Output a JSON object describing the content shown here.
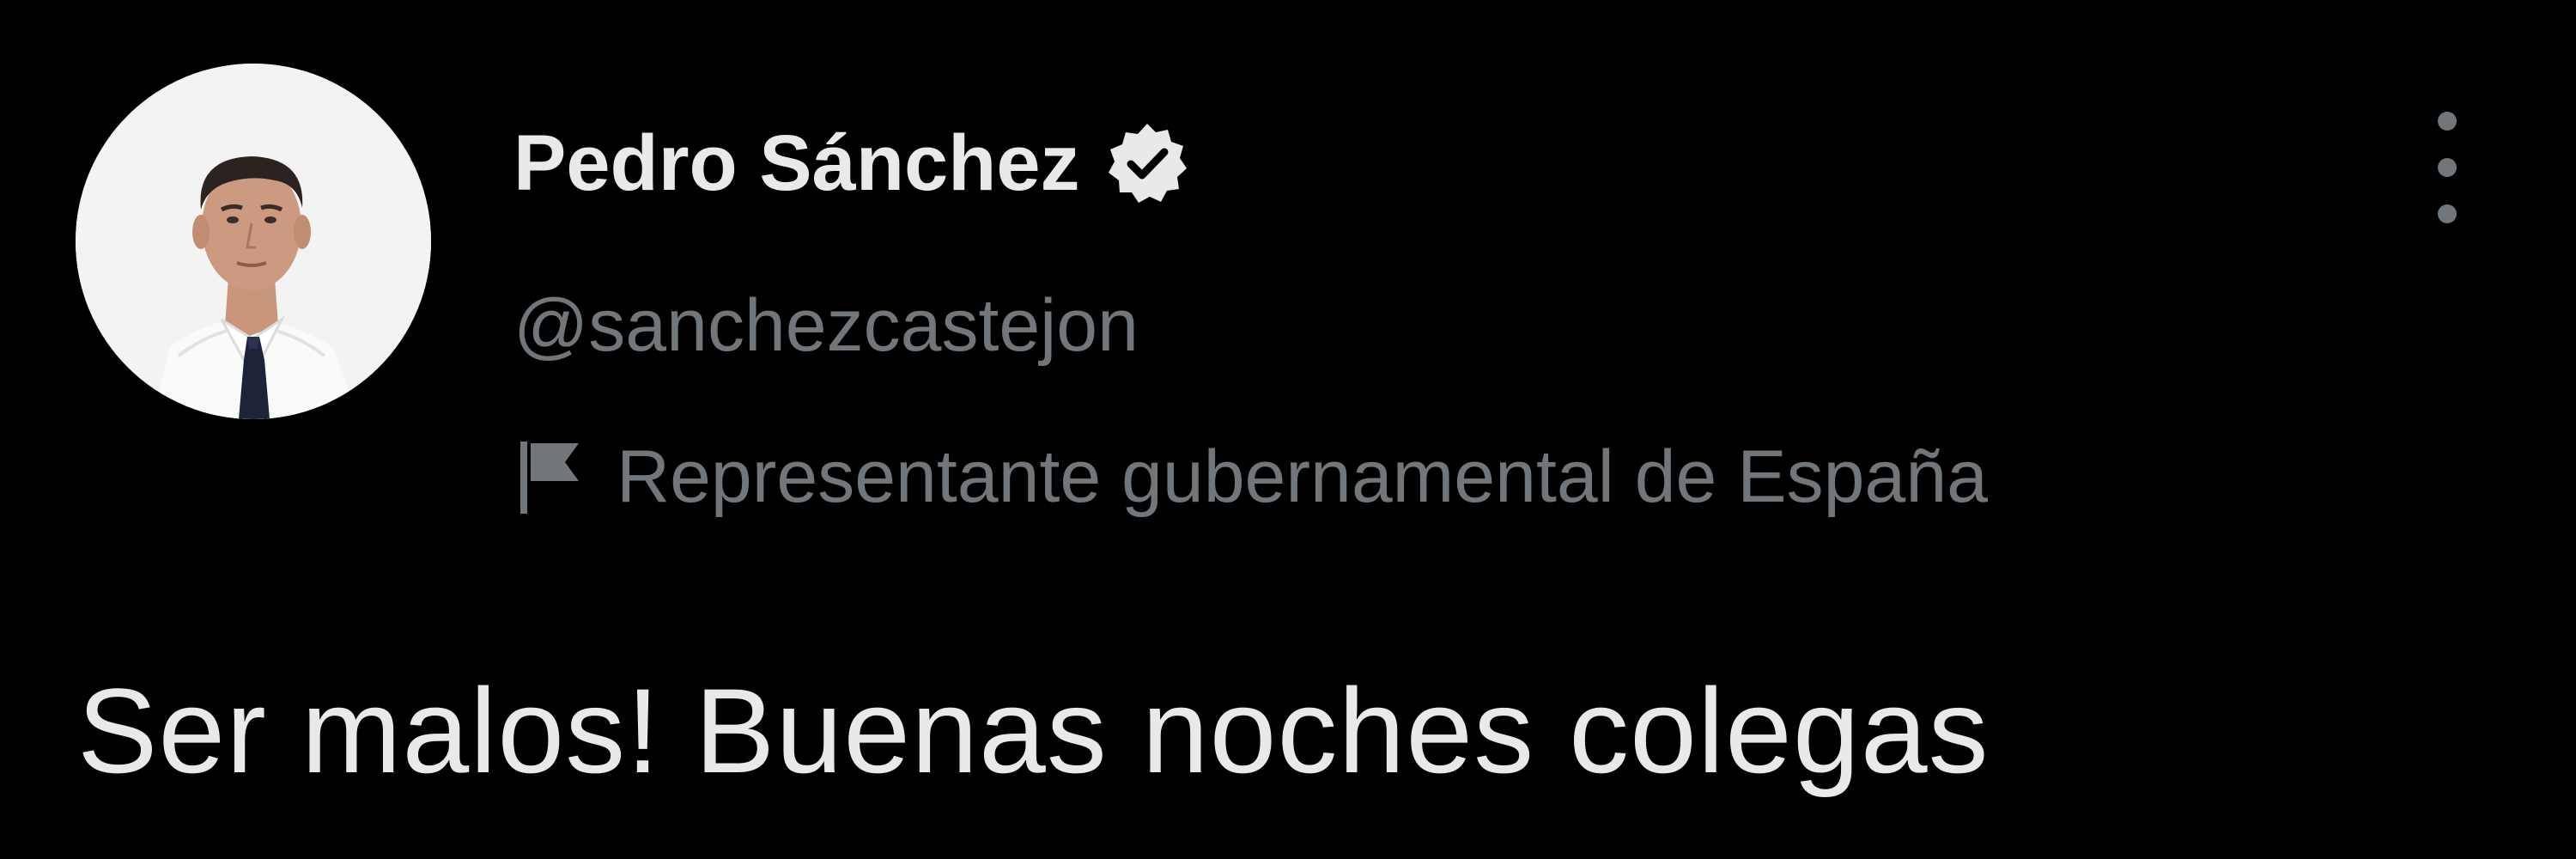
{
  "author": {
    "display_name": "Pedro Sánchez",
    "handle": "@sanchezcastejon",
    "affiliation_label": "Representante gubernamental de España",
    "verified": true
  },
  "icons": {
    "verified": "verified-badge-icon",
    "affiliation": "flag-icon",
    "more": "more-vertical-icon"
  },
  "tweet": {
    "text": "Ser malos! Buenas noches colegas"
  },
  "colors": {
    "background": "#000000",
    "primary_text": "#e7e9ea",
    "secondary_text": "#71767b"
  }
}
